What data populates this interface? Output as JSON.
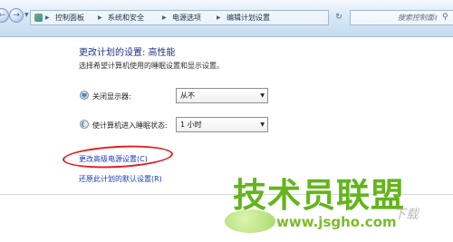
{
  "address_bar": {
    "breadcrumbs": [
      "控制面板",
      "系统和安全",
      "电源选项",
      "编辑计划设置"
    ],
    "search_placeholder": "搜索控制面板"
  },
  "main": {
    "title": "更改计划的设置: 高性能",
    "description": "选择希望计算机使用的睡眠设置和显示设置。",
    "settings": [
      {
        "label": "关闭显示器:",
        "value": "从不",
        "icon": "monitor-icon"
      },
      {
        "label": "使计算机进入睡眠状态:",
        "value": "1 小时",
        "icon": "sleep-moon-icon"
      }
    ],
    "links": {
      "advanced": "更改高级电源设置(C)",
      "restore": "还原此计划的默认设置(R)"
    },
    "highlight_color": "#e11f1f"
  },
  "watermark": {
    "title": "技术员联盟",
    "url": "www.jsgho.com",
    "side_text": "下载"
  }
}
